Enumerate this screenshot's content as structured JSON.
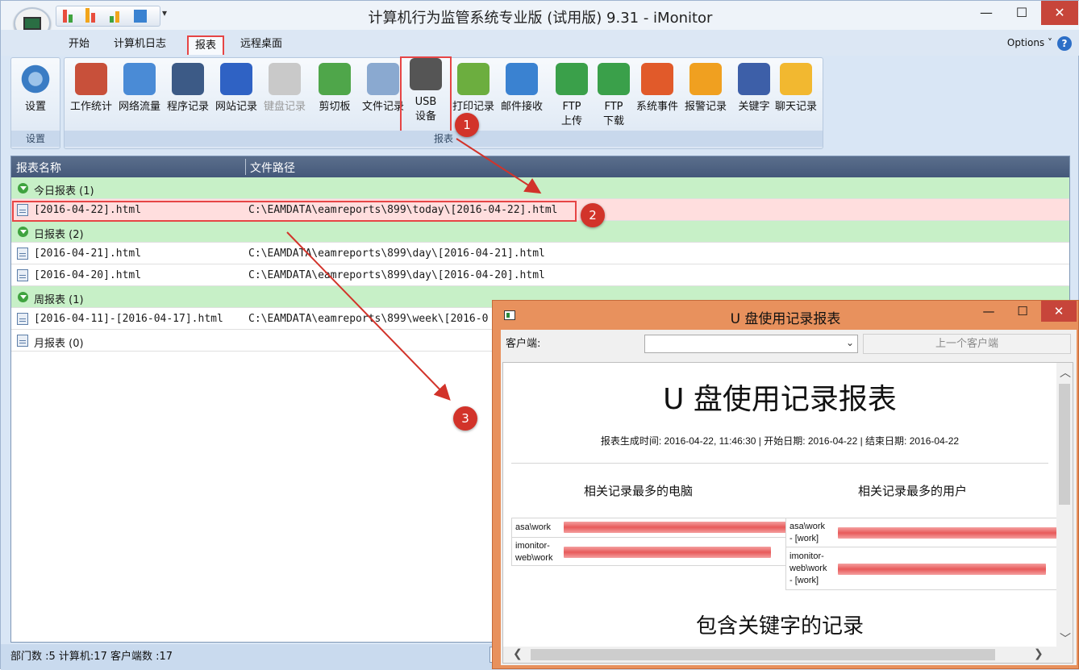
{
  "window": {
    "title": "计算机行为监管系统专业版 (试用版) 9.31 - iMonitor",
    "minimize": "—",
    "maximize": "☐",
    "close": "✕",
    "qat_arrow": "▾"
  },
  "tabs": [
    {
      "label": "开始"
    },
    {
      "label": "计算机日志"
    },
    {
      "label": "报表"
    },
    {
      "label": "远程桌面"
    }
  ],
  "options": "Options ˅",
  "help": "?",
  "ribbon": {
    "settings_group": {
      "button": "设置",
      "label": "设置"
    },
    "reports_group_label": "报表",
    "buttons": [
      {
        "label": "工作统计",
        "icon": "people-stats-icon",
        "color": "#c8503a"
      },
      {
        "label": "网络流量",
        "icon": "network-monitors-icon",
        "color": "#4a8bd6"
      },
      {
        "label": "程序记录",
        "icon": "console-window-icon",
        "color": "#3c5a86"
      },
      {
        "label": "网站记录",
        "icon": "globe-icon",
        "color": "#2f62c4"
      },
      {
        "label": "键盘记录",
        "icon": "keyboard-icon",
        "color": "#c9c9c9"
      },
      {
        "label": "剪切板",
        "icon": "clipboard-icon",
        "color": "#4fa64a"
      },
      {
        "label": "文件记录",
        "icon": "file-document-icon",
        "color": "#8aa9d0"
      },
      {
        "label": "USB\n设备",
        "icon": "usb-drive-icon",
        "color": "#555555"
      },
      {
        "label": "打印记录",
        "icon": "printer-icon",
        "color": "#6cae3f"
      },
      {
        "label": "邮件接收",
        "icon": "mail-envelope-icon",
        "color": "#3a82d1"
      },
      {
        "label": "FTP\n上传",
        "icon": "upload-arrow-icon",
        "color": "#3aa04a"
      },
      {
        "label": "FTP\n下载",
        "icon": "download-arrow-icon",
        "color": "#3aa04a"
      },
      {
        "label": "系统事件",
        "icon": "windows-logo-icon",
        "color": "#e15a2a"
      },
      {
        "label": "报警记录",
        "icon": "warning-triangle-icon",
        "color": "#f0a020"
      },
      {
        "label": "关键字",
        "icon": "keyword-document-icon",
        "color": "#3d5fa8"
      },
      {
        "label": "聊天记录",
        "icon": "chat-bubbles-icon",
        "color": "#f2b830"
      }
    ]
  },
  "grid": {
    "col_name": "报表名称",
    "col_path": "文件路径",
    "groups": [
      {
        "title": "今日报表 (1)",
        "rows": [
          {
            "name": "[2016-04-22].html",
            "path": "C:\\EAMDATA\\eamreports\\899\\today\\[2016-04-22].html"
          }
        ]
      },
      {
        "title": "日报表 (2)",
        "rows": [
          {
            "name": "[2016-04-21].html",
            "path": "C:\\EAMDATA\\eamreports\\899\\day\\[2016-04-21].html"
          },
          {
            "name": "[2016-04-20].html",
            "path": "C:\\EAMDATA\\eamreports\\899\\day\\[2016-04-20].html"
          }
        ]
      },
      {
        "title": "周报表 (1)",
        "rows": [
          {
            "name": "[2016-04-11]-[2016-04-17].html",
            "path": "C:\\EAMDATA\\eamreports\\899\\week\\[2016-0"
          }
        ]
      }
    ],
    "month_row": "月报表 (0)"
  },
  "status": "部门数 :5  计算机:17  客户端数 :17",
  "badges": [
    "1",
    "2",
    "3"
  ],
  "dialog": {
    "title": "U 盘使用记录报表",
    "client_label": "客户端:",
    "prev_client": "上一个客户端",
    "report": {
      "title": "U 盘使用记录报表",
      "meta": "报表生成时间: 2016-04-22, 11:46:30 | 开始日期: 2016-04-22 | 结束日期: 2016-04-22",
      "section_left": "相关记录最多的电脑",
      "section_right": "相关记录最多的用户",
      "left_rows": [
        {
          "label": "asa\\work",
          "value": 1.0
        },
        {
          "label": "imonitor-\nweb\\work",
          "value": 0.93
        }
      ],
      "right_rows": [
        {
          "label": "asa\\work\n- [work]",
          "value": 1.0
        },
        {
          "label": "imonitor-\nweb\\work\n- [work]",
          "value": 0.95
        }
      ],
      "subtitle": "包含关键字的记录"
    }
  },
  "colors": {
    "highlight": "#e64545",
    "group_row": "#c7f0c7",
    "selected_row": "#ffdede",
    "dialog_border": "#e8915d"
  }
}
